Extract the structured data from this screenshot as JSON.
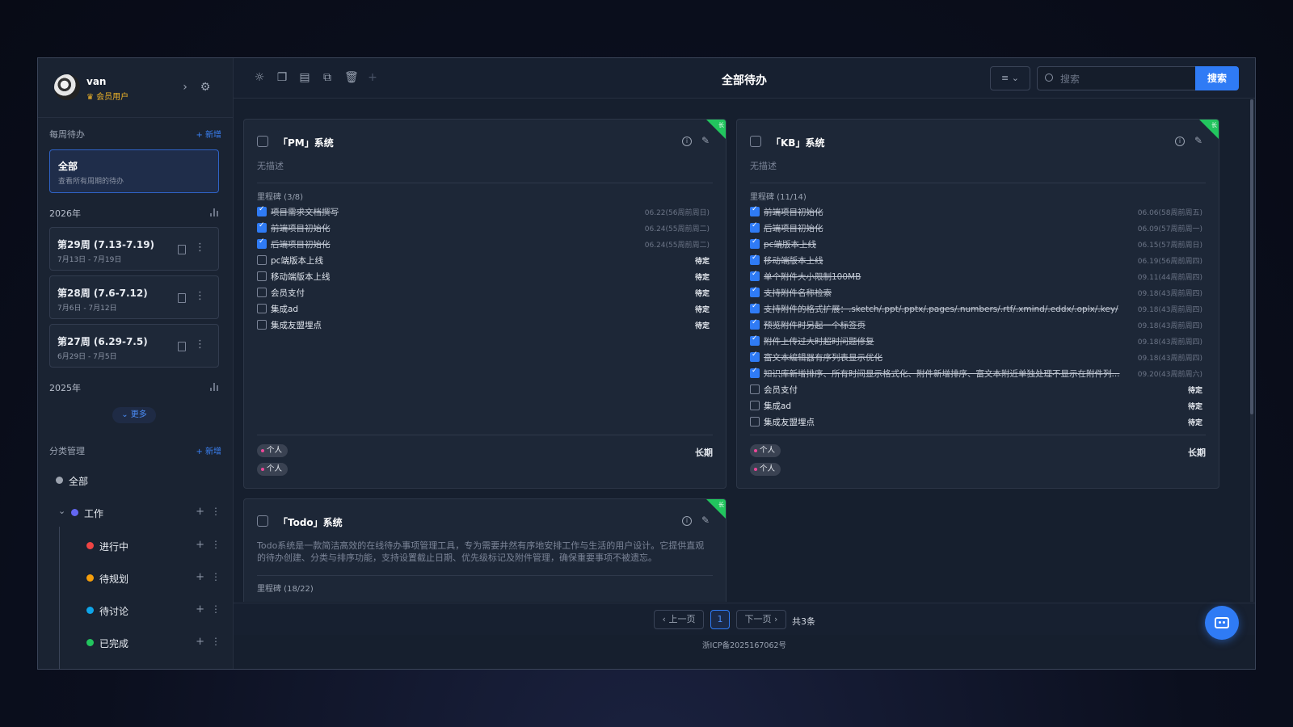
{
  "user": {
    "name": "van",
    "badge": "会员用户"
  },
  "weekly": {
    "title": "每周待办",
    "add": "+ 新增",
    "all": {
      "title": "全部",
      "subtitle": "查看所有周期的待办"
    },
    "years": [
      {
        "year": "2026年"
      },
      {
        "year": "2025年"
      }
    ],
    "weeks": [
      {
        "title": "第29周 (7.13-7.19)",
        "range": "7月13日 - 7月19日"
      },
      {
        "title": "第28周 (7.6-7.12)",
        "range": "7月6日 - 7月12日"
      },
      {
        "title": "第27周 (6.29-7.5)",
        "range": "6月29日 - 7月5日"
      }
    ],
    "more": "⌄ 更多"
  },
  "categories": {
    "title": "分类管理",
    "add": "+ 新增",
    "items": [
      {
        "label": "全部",
        "color": "#9ca3af"
      },
      {
        "label": "工作",
        "color": "#6366f1"
      },
      {
        "label": "进行中",
        "color": "#ef4444"
      },
      {
        "label": "待规划",
        "color": "#f59e0b"
      },
      {
        "label": "待讨论",
        "color": "#0ea5e9"
      },
      {
        "label": "已完成",
        "color": "#22c55e"
      }
    ]
  },
  "header": {
    "title": "全部待办",
    "search_placeholder": "搜索",
    "search_button": "搜索"
  },
  "cards": [
    {
      "title": "「PM」系统",
      "corner": "长",
      "description": "无描述",
      "milestone_head": "里程碑 (3/8)",
      "term": "长期",
      "tags": [
        "个人",
        "个人"
      ],
      "milestones": [
        {
          "label": "项目需求文档撰写",
          "done": true,
          "date": "06.22(56周前周日)"
        },
        {
          "label": "前端项目初始化",
          "done": true,
          "date": "06.24(55周前周二)"
        },
        {
          "label": "后端项目初始化",
          "done": true,
          "date": "06.24(55周前周二)"
        },
        {
          "label": "pc端版本上线",
          "done": false,
          "date": "待定"
        },
        {
          "label": "移动端版本上线",
          "done": false,
          "date": "待定"
        },
        {
          "label": "会员支付",
          "done": false,
          "date": "待定"
        },
        {
          "label": "集成ad",
          "done": false,
          "date": "待定"
        },
        {
          "label": "集成友盟埋点",
          "done": false,
          "date": "待定"
        }
      ]
    },
    {
      "title": "「KB」系统",
      "corner": "长",
      "description": "无描述",
      "milestone_head": "里程碑 (11/14)",
      "term": "长期",
      "tags": [
        "个人",
        "个人"
      ],
      "milestones": [
        {
          "label": "前端项目初始化",
          "done": true,
          "date": "06.06(58周前周五)"
        },
        {
          "label": "后端项目初始化",
          "done": true,
          "date": "06.09(57周前周一)"
        },
        {
          "label": "pc端版本上线",
          "done": true,
          "date": "06.15(57周前周日)"
        },
        {
          "label": "移动端版本上线",
          "done": true,
          "date": "06.19(56周前周四)"
        },
        {
          "label": "单个附件大小限制100MB",
          "done": true,
          "date": "09.11(44周前周四)"
        },
        {
          "label": "支持附件名称检索",
          "done": true,
          "date": "09.18(43周前周四)"
        },
        {
          "label": "支持附件的格式扩展：.sketch/.ppt/.pptx/.pages/.numbers/.rtf/.xmind/.eddx/.oplx/.key/",
          "done": true,
          "date": "09.18(43周前周四)"
        },
        {
          "label": "预览附件时另起一个标签页",
          "done": true,
          "date": "09.18(43周前周四)"
        },
        {
          "label": "附件上传过大时超时问题修复",
          "done": true,
          "date": "09.18(43周前周四)"
        },
        {
          "label": "富文本编辑器有序列表显示优化",
          "done": true,
          "date": "09.18(43周前周四)"
        },
        {
          "label": "知识库新增排序、所有时间显示格式化、附件新增排序、富文本附近单独处理不显示在附件列...",
          "done": true,
          "date": "09.20(43周前周六)"
        },
        {
          "label": "会员支付",
          "done": false,
          "date": "待定"
        },
        {
          "label": "集成ad",
          "done": false,
          "date": "待定"
        },
        {
          "label": "集成友盟埋点",
          "done": false,
          "date": "待定"
        }
      ]
    },
    {
      "title": "「Todo」系统",
      "corner": "长",
      "description": "Todo系统是一款简洁高效的在线待办事项管理工具，专为需要井然有序地安排工作与生活的用户设计。它提供直观的待办创建、分类与排序功能，支持设置截止日期、优先级标记及附件管理，确保重要事项不被遗忘。",
      "milestone_head": "里程碑 (18/22)"
    }
  ],
  "pager": {
    "prev": "‹ 上一页",
    "current": "1",
    "next": "下一页 ›",
    "total": "共3条"
  },
  "footer": {
    "icp": "浙ICP备2025167062号"
  },
  "colors": {
    "accent": "#2f7bf5",
    "corner": "#22c55e"
  }
}
